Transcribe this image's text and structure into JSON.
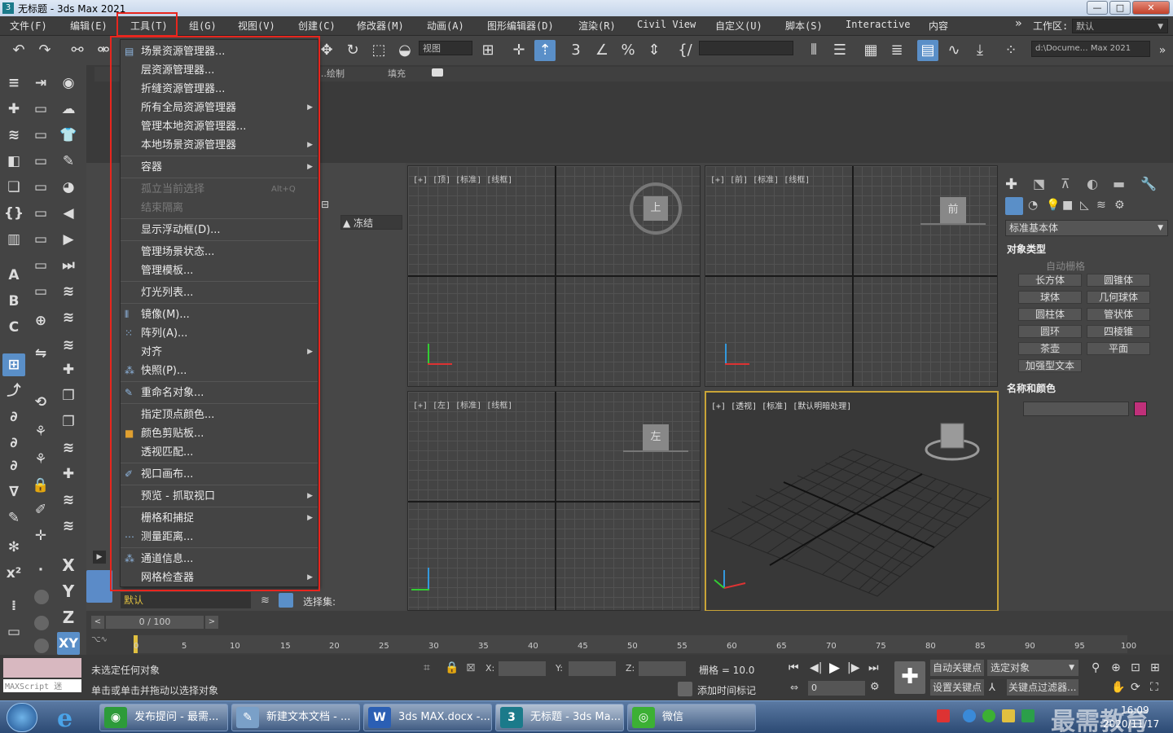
{
  "window": {
    "title": "无标题 - 3ds Max 2021",
    "min": "—",
    "max": "□",
    "close": "✕"
  },
  "menubar": {
    "items": [
      "文件(F)",
      "编辑(E)",
      "工具(T)",
      "组(G)",
      "视图(V)",
      "创建(C)",
      "修改器(M)",
      "动画(A)",
      "图形编辑器(D)",
      "渲染(R)",
      "Civil View",
      "自定义(U)",
      "脚本(S)",
      "Interactive",
      "内容"
    ],
    "workspace_label": "工作区:",
    "workspace_value": "默认",
    "chevron": "»"
  },
  "toolbar": {
    "view_combo": "视图",
    "path_combo": "d:\\Docume… Max 2021"
  },
  "ribbon": {
    "labels": [
      "…绘制",
      "填充"
    ]
  },
  "scene_explorer": {
    "column": "▲ 冻结"
  },
  "tools_menu": {
    "items": [
      {
        "label": "场景资源管理器...",
        "icon": "grid-icon"
      },
      {
        "label": "层资源管理器..."
      },
      {
        "label": "折缝资源管理器..."
      },
      {
        "label": "所有全局资源管理器",
        "submenu": true
      },
      {
        "label": "管理本地资源管理器..."
      },
      {
        "label": "本地场景资源管理器",
        "submenu": true
      },
      {
        "label": "容器",
        "submenu": true
      },
      {
        "label": "孤立当前选择",
        "shortcut": "Alt+Q",
        "disabled": true
      },
      {
        "label": "结束隔离",
        "disabled": true
      },
      {
        "label": "显示浮动框(D)..."
      },
      {
        "label": "管理场景状态..."
      },
      {
        "label": "管理模板..."
      },
      {
        "label": "灯光列表..."
      },
      {
        "label": "镜像(M)...",
        "icon": "mirror-icon"
      },
      {
        "label": "阵列(A)...",
        "icon": "array-icon"
      },
      {
        "label": "对齐",
        "submenu": true
      },
      {
        "label": "快照(P)...",
        "icon": "snapshot-icon"
      },
      {
        "label": "重命名对象...",
        "icon": "rename-icon"
      },
      {
        "label": "指定顶点颜色..."
      },
      {
        "label": "颜色剪贴板...",
        "icon": "color-clipboard-icon"
      },
      {
        "label": "透视匹配..."
      },
      {
        "label": "视口画布...",
        "icon": "brush-icon"
      },
      {
        "label": "预览 - 抓取视口",
        "submenu": true
      },
      {
        "label": "栅格和捕捉",
        "submenu": true
      },
      {
        "label": "测量距离...",
        "icon": "measure-icon"
      },
      {
        "label": "通道信息...",
        "icon": "channel-icon"
      },
      {
        "label": "网格检查器",
        "submenu": true
      }
    ]
  },
  "viewports": {
    "top": "[+] [顶] [标准] [线框]",
    "front": "[+] [前] [标准] [线框]",
    "left": "[+] [左] [标准] [线框]",
    "persp": "[+] [透视] [标准] [默认明暗处理]",
    "viewcube_top": "上",
    "viewcube_front": "前",
    "viewcube_left": "左"
  },
  "command_panel": {
    "category": "标准基本体",
    "object_type_header": "对象类型",
    "autogrid": "自动栅格",
    "buttons": [
      "长方体",
      "圆锥体",
      "球体",
      "几何球体",
      "圆柱体",
      "管状体",
      "圆环",
      "四棱锥",
      "茶壶",
      "平面",
      "加强型文本"
    ],
    "name_color_header": "名称和颜色",
    "color": "#c0307a"
  },
  "layer_bar": {
    "layer": "默认",
    "selection_set": "选择集:"
  },
  "timeline": {
    "frame": "0 / 100",
    "ticks": [
      "0",
      "5",
      "10",
      "15",
      "20",
      "25",
      "30",
      "35",
      "40",
      "45",
      "50",
      "55",
      "60",
      "65",
      "70",
      "75",
      "80",
      "85",
      "90",
      "95",
      "100"
    ]
  },
  "status": {
    "line1": "未选定任何对象",
    "line2": "单击或单击并拖动以选择对象",
    "maxscript": "MAXScript 迷",
    "x_label": "X:",
    "y_label": "Y:",
    "z_label": "Z:",
    "grid": "栅格 = 10.0",
    "add_time_tag": "添加时间标记",
    "auto_key": "自动关键点",
    "set_key": "设置关键点",
    "selected_object": "选定对象",
    "key_filter": "关键点过滤器...",
    "frame_value": "0"
  },
  "axis_buttons": [
    "X",
    "Y",
    "Z",
    "XY"
  ],
  "taskbar": {
    "tasks": [
      {
        "label": "发布提问 - 最需...",
        "color": "#2d9b3a"
      },
      {
        "label": "新建文本文档 - ...",
        "color": "#7aa0c8"
      },
      {
        "label": "3ds MAX.docx -...",
        "color": "#2b5fb4"
      },
      {
        "label": "无标题 - 3ds Ma...",
        "color": "#1b7a8a"
      },
      {
        "label": "微信",
        "color": "#3cb034"
      }
    ],
    "time": "16:09",
    "date": "2020/11/17",
    "watermark": "最需教育"
  }
}
